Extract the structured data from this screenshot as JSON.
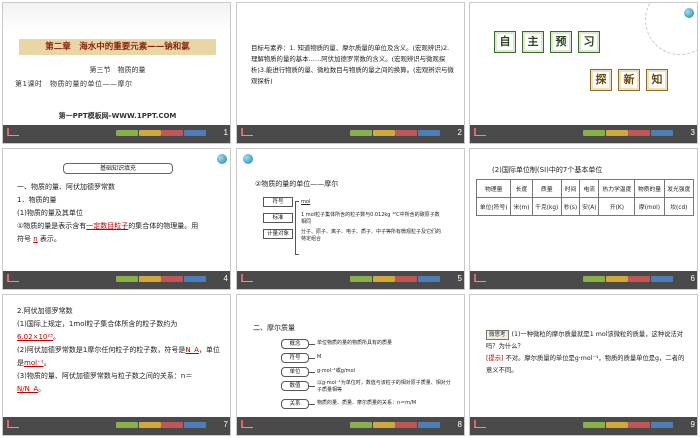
{
  "slides": [
    {
      "number": "1",
      "chapter_title": "第二章　海水中的重要元素——钠和氯",
      "section": "第三节　物质的量",
      "lesson": "第1课时　物质的量的单位——摩尔",
      "brand": "第一PPT模板网-WWW.1PPT.COM"
    },
    {
      "number": "2",
      "objectives": "目标与素养：1. 知道物质的量、摩尔质量的单位及含义。(宏观辨识)2.理解物质的量的基本……阿伏加德罗常数的含义。(宏观辨识与微观探析)3.能进行物质的量、微粒数目与物质的量之间的换算。(宏观辨识与微观探析)"
    },
    {
      "number": "3",
      "row1": [
        "自",
        "主",
        "预",
        "习"
      ],
      "row2": [
        "探",
        "新",
        "知"
      ]
    },
    {
      "number": "4",
      "banner": "基础知识填充",
      "heading": "一、物质的量、阿伏加德罗常数",
      "sub1": "1．物质的量",
      "sub2": "(1)物质的量及其单位",
      "line1_a": "①物质的量是表示含有",
      "line1_blank": "一定数目粒子",
      "line1_b": "的集合体的物理量。用",
      "line2_a": "符号",
      "line2_blank": "n",
      "line2_b": "表示。"
    },
    {
      "number": "5",
      "heading": "②物质的量的单位——摩尔",
      "node1": "符号",
      "node1_value": "mol",
      "node2": "标准",
      "node2_text": "1 mol粒子集体所含的粒子数与0.012kg ¹²C中所含的碳原子数相同",
      "node3": "计量对象",
      "node3_text": "分子、原子、离子、电子、质子、中子等所有微观粒子及它们的特定组合"
    },
    {
      "number": "6",
      "heading": "(2)国际单位制(SI)中的7个基本单位",
      "table": {
        "row1": [
          "物理量",
          "长度",
          "质量",
          "时间",
          "电流",
          "热力学温度",
          "物质的量",
          "发光强度"
        ],
        "row2": [
          "单位(符号)",
          "米(m)",
          "千克(kg)",
          "秒(s)",
          "安(A)",
          "开(K)",
          "摩(mol)",
          "坎(cd)"
        ]
      }
    },
    {
      "number": "7",
      "heading": "2.阿伏加德罗常数",
      "line1": "(1)国际上规定，1mol粒子集合体所含的粒子数约为",
      "line1_value": "6.02×10²³",
      "line2": "(2)阿伏加德罗常数是1摩尔任何粒子的粒子数，符号是",
      "line2_value": "N_A",
      "line3": "，单位是",
      "line3_value": "mol⁻¹",
      "line4": "(3)物质的量、阿伏加德罗常数与粒子数之间的关系：n＝",
      "line4_value": "N/N_A"
    },
    {
      "number": "8",
      "heading": "二、摩尔质量",
      "nodes": [
        {
          "label": "概念",
          "text": "单位物质的量的物质所具有的质量"
        },
        {
          "label": "符号",
          "text": "M"
        },
        {
          "label": "单位",
          "text": "g·mol⁻¹或g/mol"
        },
        {
          "label": "数值",
          "text": "以g·mol⁻¹为单位时，数值与该粒子的相对原子质量、相对分子质量相等"
        },
        {
          "label": "关系",
          "text": "物质的量、质量、摩尔质量的关系：n＝m/M"
        }
      ]
    },
    {
      "number": "9",
      "tag_label": "微思考",
      "question": "(1)一种微粒的摩尔质量就是1 mol该微粒的质量，这种说法对吗？为什么？",
      "hint_label": "[提示]",
      "answer": "不对。摩尔质量的单位是g·mol⁻¹，物质的质量单位是g，二者的意义不同。"
    }
  ]
}
